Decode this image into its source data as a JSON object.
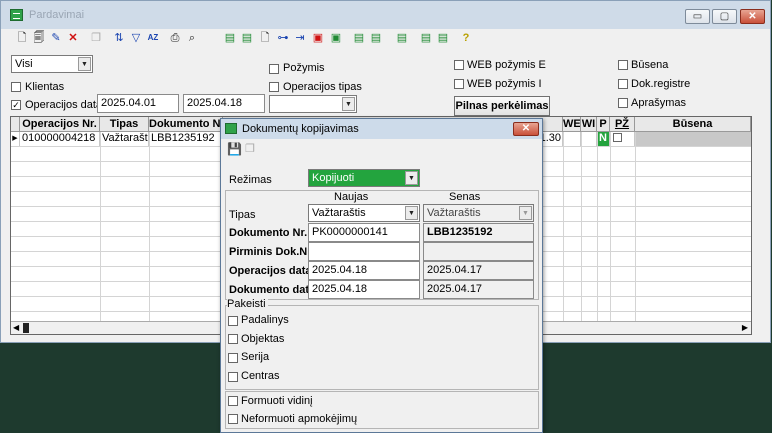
{
  "window": {
    "title": "Pardavimai",
    "minimize": "▭",
    "restore": "▢",
    "close": "✕"
  },
  "toolbar": {
    "icons": [
      "new-document-icon",
      "copy-document-icon",
      "edit-document-icon",
      "delete-icon",
      "duplicate-icon",
      "sort-icon",
      "filter-icon",
      "sort-az-icon",
      "print-icon",
      "find-icon",
      "export-green-icon",
      "export-green-2-icon",
      "document-icon",
      "tree-icon",
      "transfer-icon",
      "red-register-icon",
      "green-register-icon",
      "export-3-icon",
      "export-4-icon",
      "export-5-icon",
      "export-6-icon",
      "export-7-icon",
      "help-icon"
    ],
    "sort_az": "AZ",
    "help": "?"
  },
  "filters": {
    "type_select": "Visi",
    "klientas_label": "Klientas",
    "operacijos_data_label": "Operacijos data",
    "date_from": "2025.04.01",
    "date_to": "2025.04.18",
    "pozymis_label": "Požymis",
    "operacijos_tipas_label": "Operacijos tipas",
    "operacijos_tipas_value": "",
    "web_pozymis_e_label": "WEB požymis E",
    "web_pozymis_i_label": "WEB požymis I",
    "pilnas_perkelimas_button": "Pilnas perkėlimas",
    "busena_label": "Būsena",
    "dok_registre_label": "Dok.registre",
    "aprasymas_label": "Aprašymas"
  },
  "grid": {
    "headers": [
      "Operacijos Nr.",
      "Tipas",
      "Dokumento Nr.",
      "WE",
      "WI",
      "P",
      "PŽ",
      "Būsena"
    ],
    "row": {
      "operacijos_nr": "010000004218",
      "tipas": "Važtaraštis",
      "dokumento_nr": "LBB1235192",
      "amount_tail": "1.30",
      "p_flag": "N"
    }
  },
  "dialog": {
    "title": "Dokumentų kopijavimas",
    "rezimas_label": "Režimas",
    "rezimas_value": "Kopijuoti",
    "col_new": "Naujas",
    "col_old": "Senas",
    "tipas_label": "Tipas",
    "tipas_new": "Važtaraštis",
    "tipas_old": "Važtaraštis",
    "dok_nr_label": "Dokumento Nr.",
    "dok_nr_new": "PK0000000141",
    "dok_nr_old": "LBB1235192",
    "pirminis_label": "Pirminis Dok.Nr.",
    "pirminis_new": "",
    "pirminis_old": "",
    "op_data_label": "Operacijos data",
    "op_data_new": "2025.04.18",
    "op_data_old": "2025.04.17",
    "dok_data_label": "Dokumento data",
    "dok_data_new": "2025.04.18",
    "dok_data_old": "2025.04.17",
    "pakeisti_label": "Pakeisti",
    "padalinys_label": "Padalinys",
    "objektas_label": "Objektas",
    "serija_label": "Serija",
    "centras_label": "Centras",
    "formuoti_vidini_label": "Formuoti vidinį",
    "neformuoti_label": "Neformuoti apmokėjimų"
  }
}
